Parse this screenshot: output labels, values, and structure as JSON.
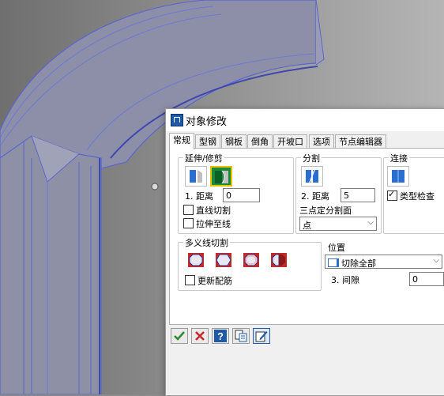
{
  "dialog": {
    "title": "对象修改",
    "tabs": [
      {
        "label": "常规",
        "active": true
      },
      {
        "label": "型钢"
      },
      {
        "label": "钢板"
      },
      {
        "label": "倒角"
      },
      {
        "label": "开坡口"
      },
      {
        "label": "选项"
      },
      {
        "label": "节点编辑器"
      }
    ]
  },
  "extend_trim": {
    "label": "延伸/修剪",
    "distance_label": "1. 距离",
    "distance_value": "0",
    "option_straight_cut": {
      "label": "直线切割",
      "checked": false
    },
    "option_extend_to_line": {
      "label": "拉伸至线",
      "checked": false
    }
  },
  "split": {
    "label": "分割",
    "distance_label": "2. 距离",
    "distance_value": "5",
    "three_point_label": "三点定分割面",
    "point_select_value": "点"
  },
  "connect": {
    "label": "连接",
    "type_check": {
      "label": "类型检查",
      "checked": true
    }
  },
  "multi_line_cut": {
    "label": "多义线切割",
    "update_rebar": {
      "label": "更新配筋",
      "checked": false
    },
    "position_label": "位置",
    "position_select_value": "切除全部",
    "gap_label": "3. 间隙",
    "gap_value": "0"
  },
  "colors": {
    "accent_blue": "#1e5aa8",
    "selected_green": "#1b8a3a",
    "selected_border": "#e6c200",
    "model_blue": "#4a5ab8"
  }
}
